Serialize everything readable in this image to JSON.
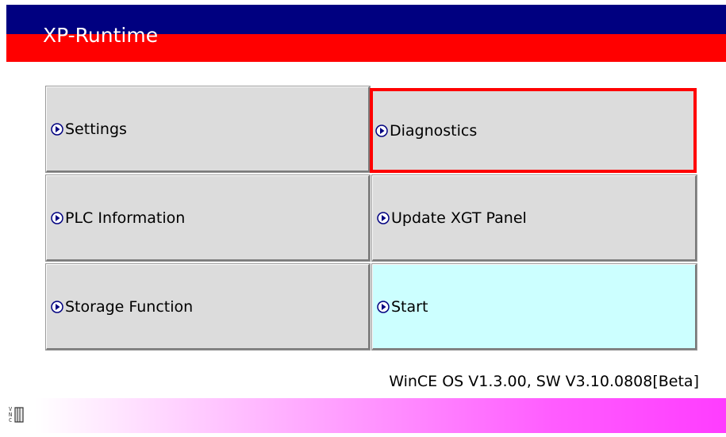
{
  "header": {
    "title": "XP-Runtime",
    "colors": {
      "top": "#000080",
      "bottom": "#ff0000"
    }
  },
  "menu": {
    "settings": {
      "label": "Settings",
      "icon": "arrow-circle-icon"
    },
    "diagnostics": {
      "label": "Diagnostics",
      "icon": "arrow-circle-icon",
      "selected": true
    },
    "plc_information": {
      "label": "PLC Information",
      "icon": "arrow-circle-icon"
    },
    "update_xgt_panel": {
      "label": "Update XGT Panel",
      "icon": "arrow-circle-icon"
    },
    "storage_function": {
      "label": "Storage Function",
      "icon": "arrow-circle-icon"
    },
    "start": {
      "label": "Start",
      "icon": "arrow-circle-icon",
      "color": "#ccffff"
    }
  },
  "version": "WinCE OS V1.3.00, SW V3.10.0808[Beta]",
  "footer": {
    "icon": "vnc-icon",
    "gradient_color": "#ff3cff"
  }
}
